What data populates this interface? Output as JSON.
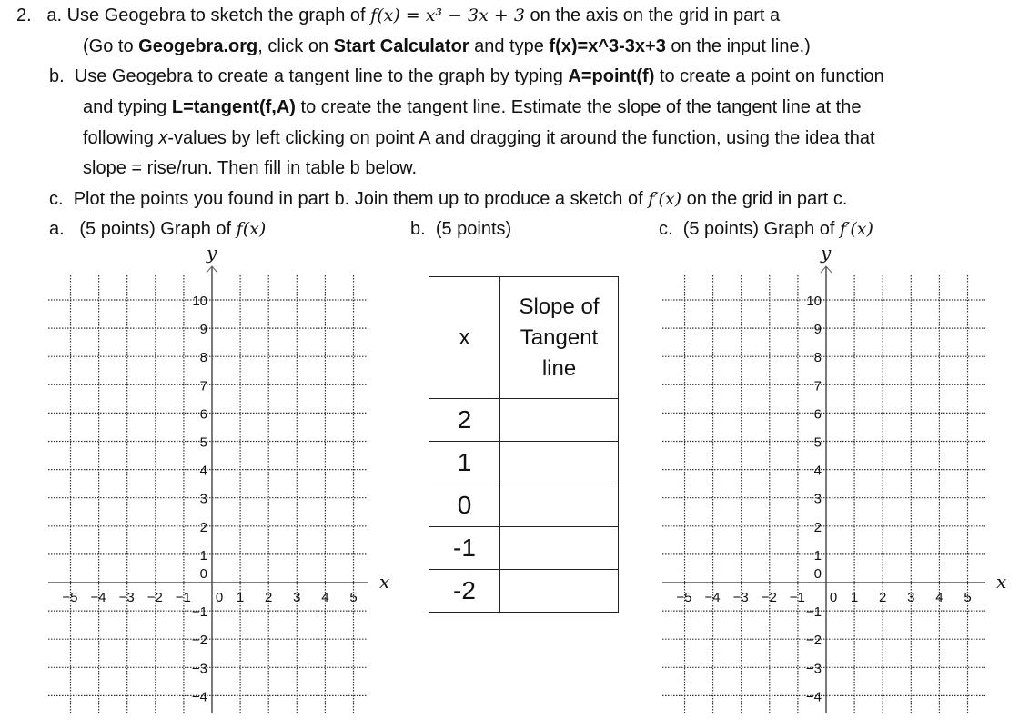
{
  "question": {
    "number": "2.",
    "part_a": {
      "marker": "a.",
      "text_before": "Use Geogebra to sketch the graph of ",
      "function": "f(x) = x³ − 3x + 3",
      "text_after": " on the axis on the grid in part a",
      "line2_open": "(Go to ",
      "site": "Geogebra.org",
      "line2_mid1": ", click on ",
      "button": "Start Calculator",
      "line2_mid2": " and type ",
      "command": "f(x)=x^3-3x+3",
      "line2_end": " on the input line.)"
    },
    "part_b": {
      "marker": "b.",
      "line1_start": "Use Geogebra to create a tangent line to the graph by typing ",
      "cmd_point": "A=point(f)",
      "line1_end": " to create a point on function",
      "line2_start": "and typing ",
      "cmd_tangent": "L=tangent(f,A)",
      "line2_end": " to create the tangent line.   Estimate the slope of the tangent line at the",
      "line3_start": "following ",
      "line3_var": "x",
      "line3_end": "-values by left clicking on point A and dragging it around the function, using the idea that",
      "line4": "slope = rise/run.  Then fill in table b below."
    },
    "part_c": {
      "marker": "c.",
      "text_before": "Plot the points you found in part b.  Join them up to produce a sketch of ",
      "function": "f′(x)",
      "text_after": " on the grid in part c."
    }
  },
  "sections": {
    "a_label": "a.",
    "a_title": "(5 points) Graph of ",
    "a_func": "f(x)",
    "b_label": "b.",
    "b_title": "(5 points)",
    "c_label": "c.",
    "c_title": "(5 points) Graph of ",
    "c_func": "f′(x)"
  },
  "graphs": {
    "y_axis_label": "y",
    "x_axis_label": "x",
    "x_ticks": [
      "−5",
      "−4",
      "−3",
      "−2",
      "−1",
      "0",
      "1",
      "2",
      "3",
      "4",
      "5"
    ],
    "y_ticks": [
      "10",
      "9",
      "8",
      "7",
      "6",
      "5",
      "4",
      "3",
      "2",
      "1",
      "0",
      "−1",
      "−2",
      "−3",
      "−4"
    ]
  },
  "table": {
    "header_x": "x",
    "header_slope_lines": [
      "Slope of",
      "Tangent",
      "line"
    ],
    "rows": [
      {
        "x": "2",
        "slope": ""
      },
      {
        "x": "1",
        "slope": ""
      },
      {
        "x": "0",
        "slope": ""
      },
      {
        "x": "-1",
        "slope": ""
      },
      {
        "x": "-2",
        "slope": ""
      }
    ]
  }
}
